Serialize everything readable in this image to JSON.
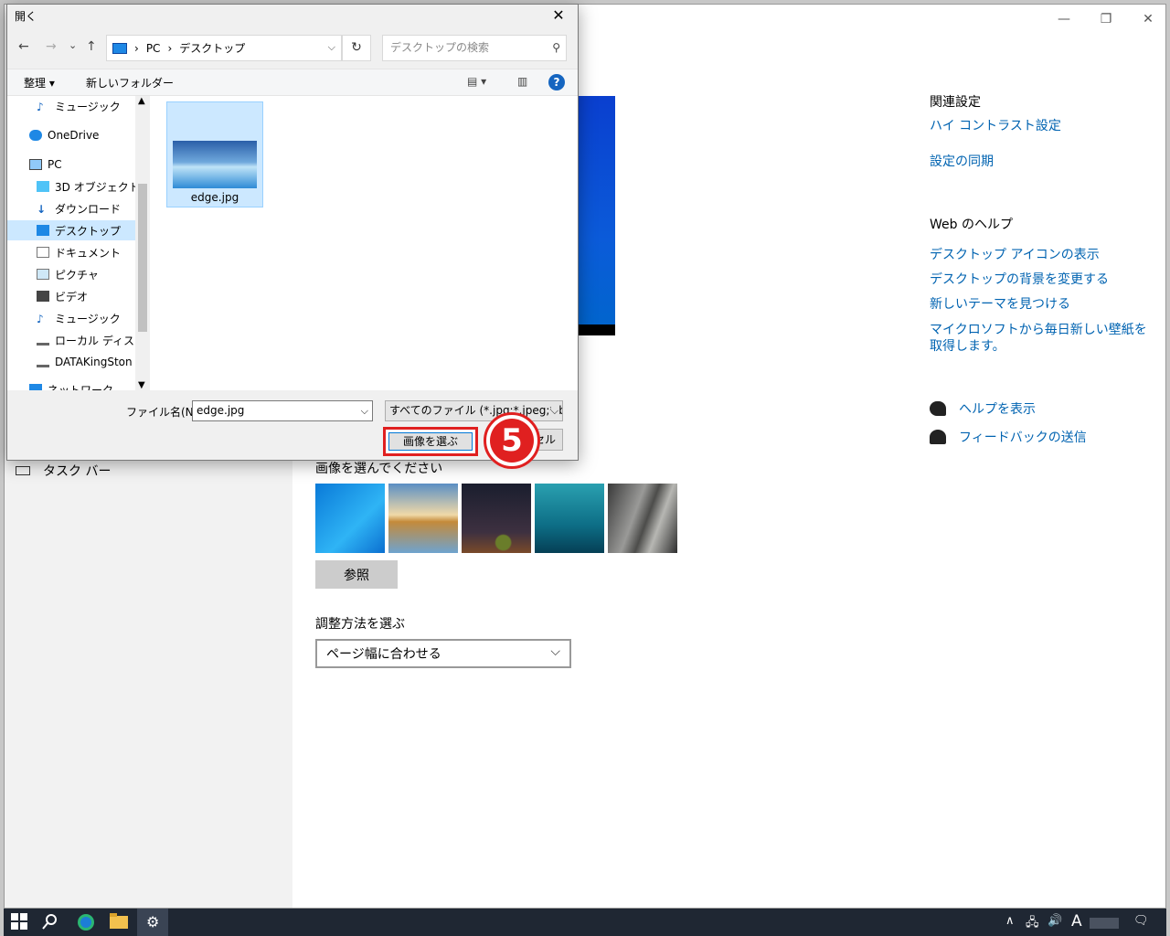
{
  "settings": {
    "window_controls": {
      "minimize": "—",
      "restore": "❐",
      "close": "✕"
    },
    "taskbar_label": "タスク バー",
    "choose_picture_label": "画像を選んでください",
    "browse_button": "参照",
    "fit_label": "調整方法を選ぶ",
    "fit_value": "ページ幅に合わせる",
    "related": {
      "heading": "関連設定",
      "links": [
        "ハイ コントラスト設定",
        "設定の同期"
      ]
    },
    "web_help": {
      "heading": "Web のヘルプ",
      "links": [
        "デスクトップ アイコンの表示",
        "デスクトップの背景を変更する",
        "新しいテーマを見つける",
        "マイクロソフトから毎日新しい壁紙を取得します。"
      ]
    },
    "help_links": [
      "ヘルプを表示",
      "フィードバックの送信"
    ]
  },
  "dialog": {
    "title": "開く",
    "close": "✕",
    "nav": {
      "back": "←",
      "forward": "→",
      "recent": "⌄",
      "up": "↑"
    },
    "address": {
      "parts": [
        "PC",
        "デスクトップ"
      ],
      "separator": "›"
    },
    "refresh": "↻",
    "search_placeholder": "デスクトップの検索",
    "commands": {
      "organize": "整理 ▾",
      "new_folder": "新しいフォルダー",
      "help": "?"
    },
    "nav_items": [
      {
        "label": "ミュージック",
        "icon": "music-icon"
      },
      {
        "label": "OneDrive",
        "icon": "cloud-icon"
      },
      {
        "label": "PC",
        "icon": "pc-icon"
      },
      {
        "label": "3D オブジェクト",
        "icon": "cube-icon"
      },
      {
        "label": "ダウンロード",
        "icon": "download-icon"
      },
      {
        "label": "デスクトップ",
        "icon": "desktop-icon"
      },
      {
        "label": "ドキュメント",
        "icon": "document-icon"
      },
      {
        "label": "ピクチャ",
        "icon": "picture-icon"
      },
      {
        "label": "ビデオ",
        "icon": "video-icon"
      },
      {
        "label": "ミュージック",
        "icon": "music-icon"
      },
      {
        "label": "ローカル ディスク (C",
        "icon": "drive-icon"
      },
      {
        "label": "DATAKingSton (",
        "icon": "drive-icon"
      },
      {
        "label": "ネットワーク",
        "icon": "network-icon"
      }
    ],
    "file": {
      "name": "edge.jpg"
    },
    "filename_label": "ファイル名(N):",
    "filename_value": "edge.jpg",
    "filetype_value": "すべてのファイル (*.jpg;*.jpeg;*.bmp",
    "choose_button": "画像を選ぶ",
    "cancel_button": "キャンセル",
    "step_marker": "5"
  },
  "taskbar": {
    "tray": {
      "chevron": "∧",
      "ime": "A"
    }
  },
  "colors": {
    "accent": "#0063b1",
    "highlight": "#e02020",
    "selection": "#cce8ff"
  }
}
